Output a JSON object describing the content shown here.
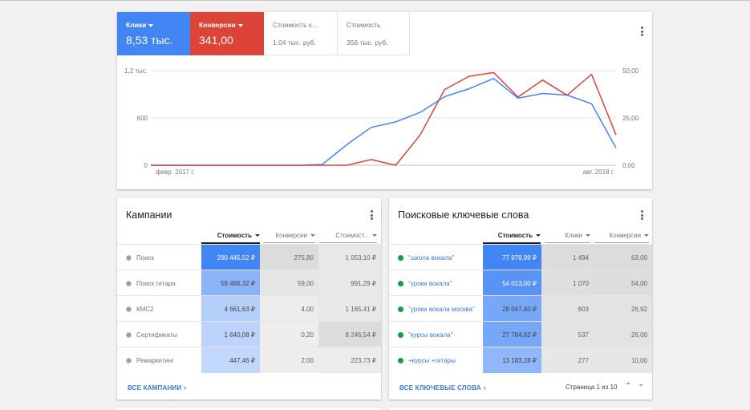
{
  "overview": {
    "metrics": [
      {
        "label": "Клики",
        "value": "8,53 тыс."
      },
      {
        "label": "Конверсии",
        "value": "341,00"
      },
      {
        "label": "Стоимость к...",
        "value": "1,04 тыс. руб."
      },
      {
        "label": "Стоимость",
        "value": "356 тыс. руб."
      }
    ]
  },
  "chart_data": {
    "type": "line",
    "x_start_label": "февр. 2017 г.",
    "x_end_label": "авг. 2018 г.",
    "left_axis_ticks": [
      "1,2 тыс.",
      "600",
      "0"
    ],
    "right_axis_ticks": [
      "50,00",
      "25,00",
      "0,00"
    ],
    "left_ylim": [
      0,
      1200
    ],
    "right_ylim": [
      0,
      50
    ],
    "x": [
      0,
      1,
      2,
      3,
      4,
      5,
      6,
      7,
      8,
      9,
      10,
      11,
      12,
      13,
      14,
      15,
      16,
      17,
      18
    ],
    "series": [
      {
        "color": "#4285f4",
        "axis": "left",
        "values": [
          0,
          0,
          0,
          0,
          0,
          0,
          0,
          10,
          260,
          480,
          550,
          670,
          870,
          970,
          1100,
          850,
          910,
          890,
          780,
          220
        ]
      },
      {
        "color": "#db4437",
        "axis": "right",
        "values": [
          0,
          0,
          0,
          0,
          0,
          0,
          0,
          0,
          0,
          3,
          0,
          16,
          40,
          47,
          49,
          36,
          45,
          37,
          48,
          16
        ]
      }
    ],
    "grid": true
  },
  "campaigns": {
    "title": "Кампании",
    "columns": [
      "Стоимость",
      "Конверсии",
      "Стоимост..."
    ],
    "rows": [
      {
        "name": "Поиск",
        "cost": "290 445,52 ₽",
        "conv": "275,80",
        "costconv": "1 053,10 ₽"
      },
      {
        "name": "Поиск гитара",
        "cost": "58 486,32 ₽",
        "conv": "59,00",
        "costconv": "991,29 ₽"
      },
      {
        "name": "КМС2",
        "cost": "4 661,63 ₽",
        "conv": "4,00",
        "costconv": "1 165,41 ₽"
      },
      {
        "name": "Сертификаты",
        "cost": "1 640,08 ₽",
        "conv": "0,20",
        "costconv": "8 246,54 ₽"
      },
      {
        "name": "Ремаркетинг",
        "cost": "447,46 ₽",
        "conv": "2,00",
        "costconv": "223,73 ₽"
      }
    ],
    "footer_link": "ВСЕ КАМПАНИИ"
  },
  "keywords": {
    "title": "Поисковые ключевые слова",
    "columns": [
      "Стоимость",
      "Клики",
      "Конверсии"
    ],
    "rows": [
      {
        "name": "\"школа вокала\"",
        "cost": "77 979,99 ₽",
        "clicks": "1 494",
        "conv": "63,00"
      },
      {
        "name": "\"уроки вокала\"",
        "cost": "54 013,00 ₽",
        "clicks": "1 070",
        "conv": "54,00"
      },
      {
        "name": "\"уроки вокала москва\"",
        "cost": "28 047,40 ₽",
        "clicks": "603",
        "conv": "26,92"
      },
      {
        "name": "\"курсы вокала\"",
        "cost": "27 784,62 ₽",
        "clicks": "537",
        "conv": "26,00"
      },
      {
        "name": "+курсы +гитары",
        "cost": "13 183,28 ₽",
        "clicks": "277",
        "conv": "10,00"
      }
    ],
    "footer_link": "ВСЕ КЛЮЧЕВЫЕ СЛОВА",
    "pager": "Страница 1 из 10"
  },
  "colors": {
    "blue": "#4285f4",
    "red": "#db4437",
    "link": "#3c78d8",
    "heat_blue_strong": "#4285f4",
    "heat_blue_light": "#c6dafc",
    "heat_grey_strong": "#dcdcdc",
    "heat_grey_light": "#efefef"
  }
}
